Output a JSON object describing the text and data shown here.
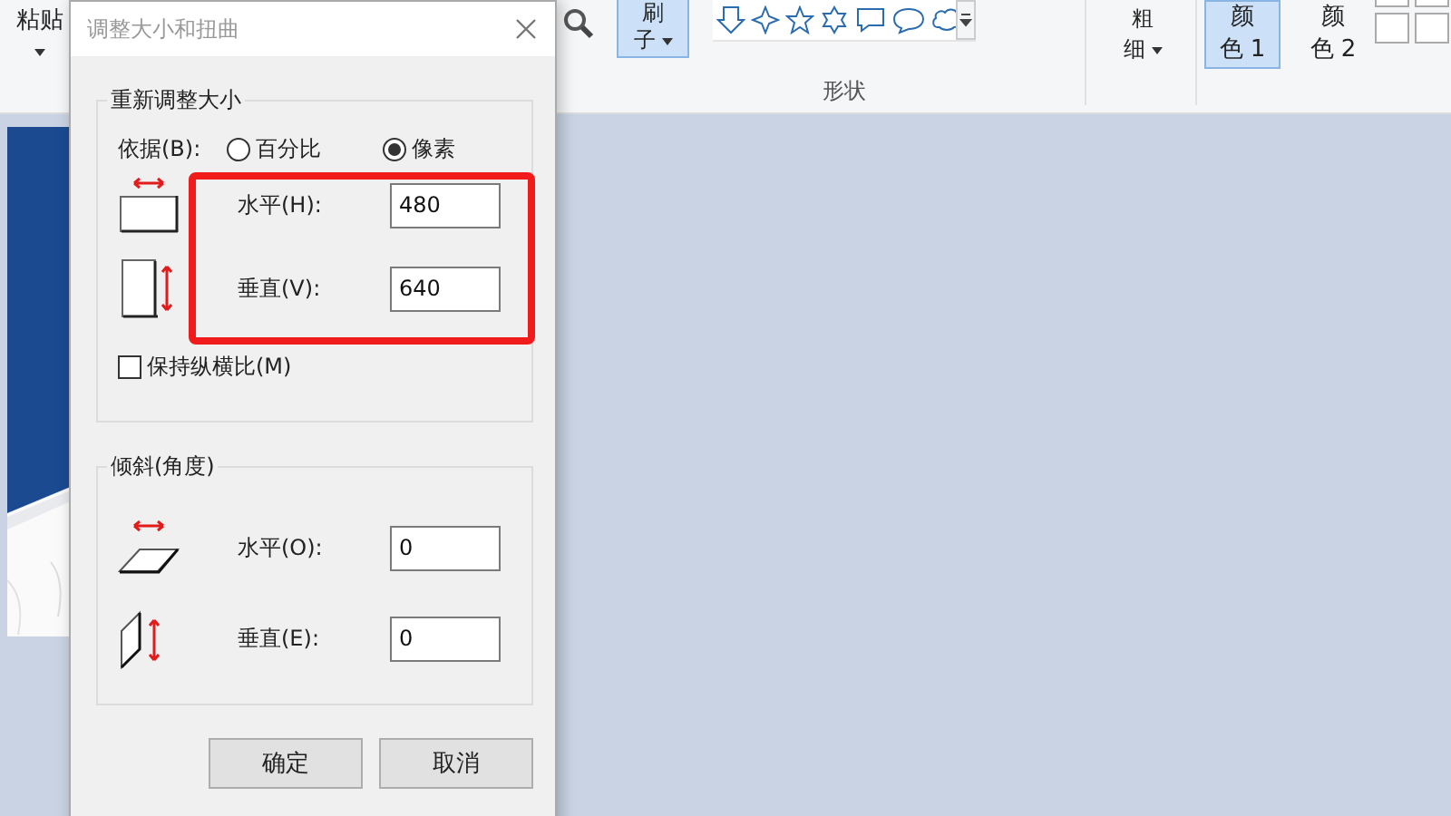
{
  "ribbon": {
    "paste": {
      "label": "粘贴"
    },
    "brush": {
      "lines": [
        "刷",
        "子"
      ],
      "selected": true
    },
    "shapes_label": "形状",
    "size": {
      "lines": [
        "粗",
        "细"
      ]
    },
    "colors": [
      {
        "lines": [
          "颜",
          "色 1"
        ],
        "selected": true
      },
      {
        "lines": [
          "颜",
          "色 2"
        ],
        "selected": false
      }
    ]
  },
  "dialog": {
    "title": "调整大小和扭曲",
    "resize": {
      "legend": "重新调整大小",
      "by_label": "依据(B):",
      "options": [
        {
          "label": "百分比",
          "selected": false
        },
        {
          "label": "像素",
          "selected": true
        }
      ],
      "fields": [
        {
          "kind": "horizontal",
          "label": "水平(H):",
          "value": "480"
        },
        {
          "kind": "vertical",
          "label": "垂直(V):",
          "value": "640"
        }
      ],
      "keep_ratio": {
        "label": "保持纵横比(M)",
        "checked": false
      }
    },
    "skew": {
      "legend": "倾斜(角度)",
      "fields": [
        {
          "kind": "horizontal",
          "label": "水平(O):",
          "value": "0"
        },
        {
          "kind": "vertical",
          "label": "垂直(E):",
          "value": "0"
        }
      ]
    },
    "buttons": [
      "确定",
      "取消"
    ]
  }
}
